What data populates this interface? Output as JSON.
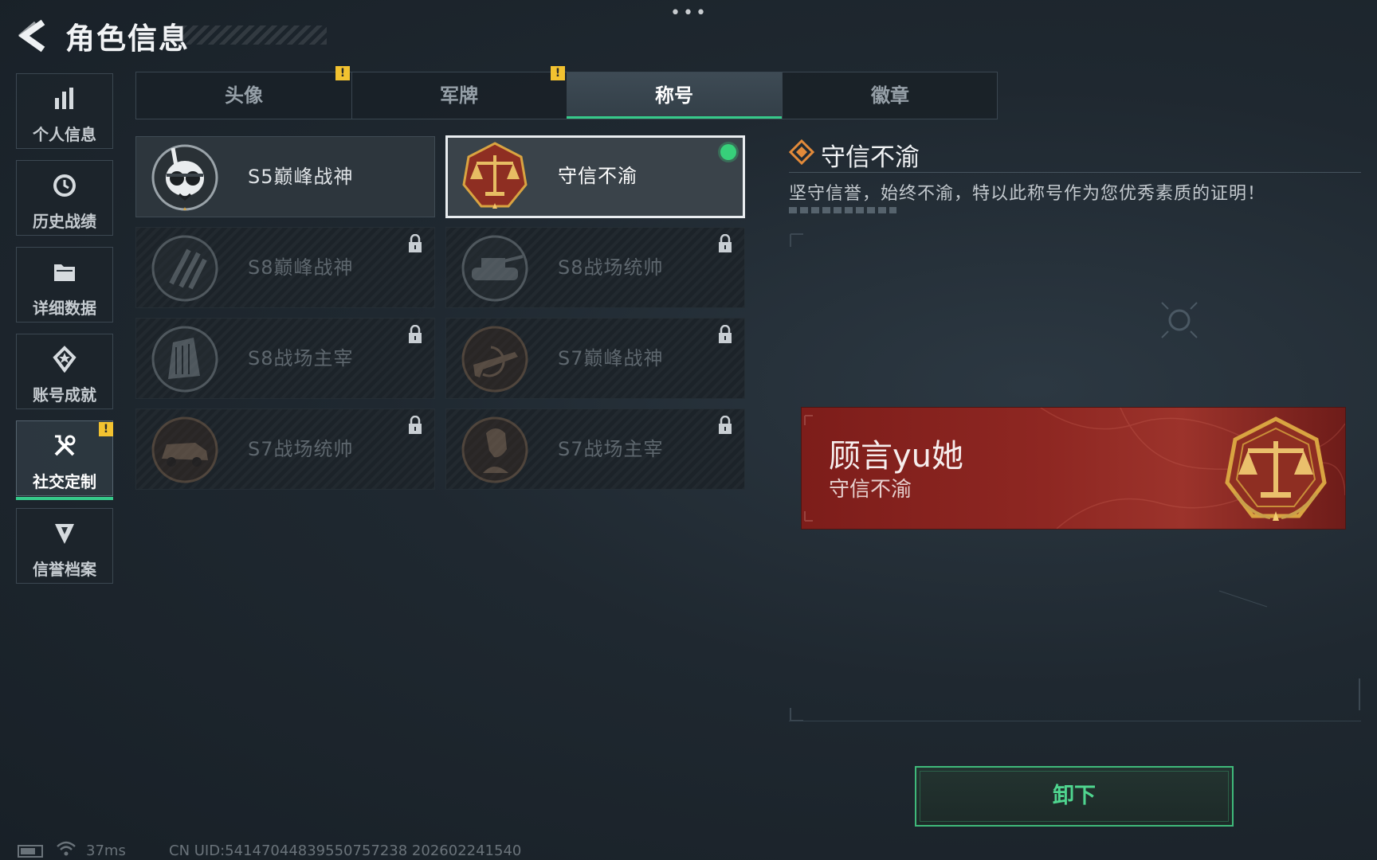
{
  "header": {
    "title": "角色信息",
    "back_icon": "back-arrow-icon",
    "more_icon": "more-dots-icon",
    "more_text": "•••"
  },
  "sidebar": {
    "items": [
      {
        "label": "个人信息",
        "icon": "bar-chart-icon",
        "active": false,
        "badge": false
      },
      {
        "label": "历史战绩",
        "icon": "history-clock-icon",
        "active": false,
        "badge": false
      },
      {
        "label": "详细数据",
        "icon": "folder-icon",
        "active": false,
        "badge": false
      },
      {
        "label": "账号成就",
        "icon": "achievement-icon",
        "active": false,
        "badge": false
      },
      {
        "label": "社交定制",
        "icon": "tools-icon",
        "active": true,
        "badge": true
      },
      {
        "label": "信誉档案",
        "icon": "reputation-shield-icon",
        "active": false,
        "badge": false
      }
    ]
  },
  "badge_text": "!",
  "tabs": [
    {
      "label": "头像",
      "active": false,
      "badge": true
    },
    {
      "label": "军牌",
      "active": false,
      "badge": true
    },
    {
      "label": "称号",
      "active": true,
      "badge": false
    },
    {
      "label": "徽章",
      "active": false,
      "badge": false
    }
  ],
  "titles": [
    {
      "name": "S5巅峰战神",
      "state": "unlocked",
      "emblem": "diver-skull-emblem-icon"
    },
    {
      "name": "守信不渝",
      "state": "selected",
      "equipped": true,
      "emblem": "scales-of-justice-emblem-icon"
    },
    {
      "name": "S8巅峰战神",
      "state": "locked",
      "emblem": "claw-marks-emblem-icon"
    },
    {
      "name": "S8战场统帅",
      "state": "locked",
      "emblem": "tank-emblem-icon"
    },
    {
      "name": "S8战场主宰",
      "state": "locked",
      "emblem": "city-tower-emblem-icon"
    },
    {
      "name": "S7巅峰战神",
      "state": "locked",
      "emblem": "rifle-emblem-icon"
    },
    {
      "name": "S7战场统帅",
      "state": "locked",
      "emblem": "armored-vehicle-emblem-icon"
    },
    {
      "name": "S7战场主宰",
      "state": "locked",
      "emblem": "soldier-bust-emblem-icon"
    }
  ],
  "detail": {
    "title": "守信不渝",
    "icon": "diamond-marker-icon",
    "description": "坚守信誉，始终不渝，特以此称号作为您优秀素质的证明！"
  },
  "banner": {
    "player_name": "顾言yu她",
    "title": "守信不渝",
    "emblem": "scales-of-justice-emblem-icon"
  },
  "unequip_button": {
    "label": "卸下"
  },
  "status_bar": {
    "ping": "37ms",
    "uid": "CN UID:54147044839550757238 202602241540"
  },
  "colors": {
    "accent_green": "#36c98a",
    "badge_yellow": "#f2c230",
    "banner_red": "#8e2722",
    "emblem_gold": "#d9a441"
  }
}
